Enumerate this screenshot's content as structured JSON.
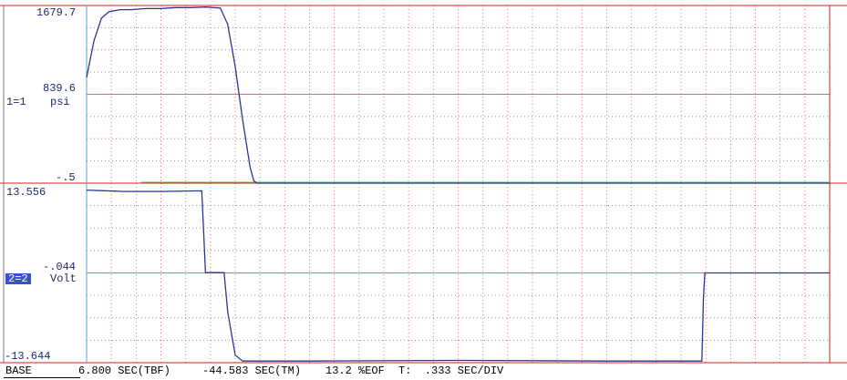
{
  "chart_data": [
    {
      "type": "line",
      "channel_id": "1=1",
      "unit": "psi",
      "tick_labels": [
        "1679.7",
        "839.6",
        "-.5"
      ],
      "ylim": [
        -0.5,
        1679.7
      ],
      "grid": true,
      "series": [
        {
          "color": "#2d3590",
          "points": [
            [
              0.0,
              1000
            ],
            [
              0.1,
              1350
            ],
            [
              0.2,
              1560
            ],
            [
              0.3,
              1620
            ],
            [
              0.45,
              1640
            ],
            [
              0.6,
              1640
            ],
            [
              0.8,
              1650
            ],
            [
              1.0,
              1650
            ],
            [
              1.2,
              1660
            ],
            [
              1.4,
              1660
            ],
            [
              1.6,
              1665
            ],
            [
              1.8,
              1655
            ],
            [
              1.9,
              1500
            ],
            [
              2.0,
              1100
            ],
            [
              2.1,
              600
            ],
            [
              2.2,
              150
            ],
            [
              2.25,
              20
            ],
            [
              2.3,
              -0.5
            ],
            [
              9.5,
              -0.5
            ],
            [
              10.0,
              -0.5
            ]
          ]
        }
      ]
    },
    {
      "type": "line",
      "channel_id": "2=2",
      "unit": "Volt",
      "tick_labels": [
        "13.556",
        "-.044",
        "-13.644"
      ],
      "ylim": [
        -13.644,
        13.556
      ],
      "grid": true,
      "series": [
        {
          "color": "#2d3590",
          "points": [
            [
              0.0,
              12.5
            ],
            [
              0.5,
              12.3
            ],
            [
              1.0,
              12.3
            ],
            [
              1.55,
              12.4
            ],
            [
              1.6,
              0.0
            ],
            [
              1.85,
              0.0
            ],
            [
              1.9,
              -6.0
            ],
            [
              2.0,
              -12.5
            ],
            [
              2.1,
              -13.4
            ],
            [
              3.0,
              -13.4
            ],
            [
              5.0,
              -13.3
            ],
            [
              7.0,
              -13.4
            ],
            [
              8.28,
              -13.4
            ],
            [
              8.3,
              -4.0
            ],
            [
              8.32,
              -0.044
            ],
            [
              9.0,
              -0.044
            ],
            [
              10.0,
              -0.044
            ]
          ]
        }
      ]
    }
  ],
  "status_bar": {
    "base_label": "BASE",
    "tbf": "6.800 SEC(TBF)",
    "tm": "-44.583 SEC(TM)",
    "eof": "13.2 %EOF",
    "tdiv": "T:  .333 SEC/DIV"
  },
  "colors": {
    "grid": "#e07070",
    "trace": "#2d3590",
    "zero_line": "#44cc44",
    "selected_channel_bg": "#3b4fd4"
  }
}
